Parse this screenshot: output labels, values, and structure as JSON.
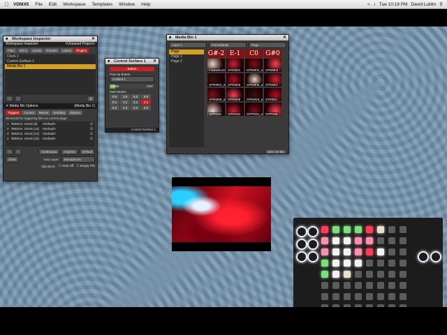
{
  "menubar": {
    "app": "VDMX5",
    "items": [
      "File",
      "Edit",
      "Workspace",
      "Templates",
      "Window",
      "Help"
    ],
    "clock": "Tue 10:19 PM",
    "user": "David Lublin"
  },
  "workspace_inspector": {
    "title": "Workspace Inspector",
    "project": "<Unsaved Project>",
    "tabs": [
      "Files",
      "Vid In",
      "Assets",
      "Presets",
      "Layers",
      "Plugins"
    ],
    "list": [
      "Clock 1",
      "Control Surface 1",
      "Media Bin 1"
    ]
  },
  "media_bin_options": {
    "title": "Media Bin Options",
    "target": "(Media Bin 1)",
    "tabs": [
      "Triggers",
      "Control",
      "Menus",
      "Sending",
      "Options"
    ],
    "shortcuts_label": "Shortcuts for triggering files on current page:",
    "rows": [
      {
        "n": "1",
        "path": "/MIDI/vn. Sinvle [8]",
        "val": "<Default>"
      },
      {
        "n": "2",
        "path": "/MIDI/vn. Sinvle [16]",
        "val": "<Default>"
      },
      {
        "n": "3",
        "path": "/MIDI/vn. Sinvle [24]",
        "val": "<Default>"
      },
      {
        "n": "4",
        "path": "/MIDI/vn. Sinvle [32]",
        "val": "<Default>"
      }
    ],
    "continuous": "Continuous",
    "anytime": "Anytime",
    "default": "Default",
    "clear": "Clear",
    "auto_layer_label": "Auto Layer:",
    "auto_layer_value": "Monophonic",
    "clip_eject_label": "Clip Eject:",
    "note_off": "Note Off",
    "empty_file": "Empty File"
  },
  "control_surface": {
    "title": "Control Surface 1",
    "button": "Button",
    "popup_label": "Pop-Up Button",
    "popup_value": "Untitled 1",
    "slider_label": "Slider",
    "slider_value": "0.07",
    "slider_level": 0.07,
    "multi_label": "Multi-Button",
    "grid": [
      "0.0",
      "1.0",
      "2.0",
      "3.0",
      "0.1",
      "1.1",
      "2.1",
      "3.1",
      "0.2",
      "1.2",
      "2.2",
      "3.2"
    ],
    "active_index": 7,
    "footer": "Control Surface 1"
  },
  "media_bin": {
    "title": "Media Bin 1",
    "layer": "Layer 1",
    "mode": "Immediately",
    "page_mode": "Page",
    "pages": [
      "Page",
      "Page 1",
      "Page 2"
    ],
    "headers": [
      "G#-2",
      "E-1",
      "C0",
      "G#0"
    ],
    "clips": [
      "FrameNumb",
      "GPEM01",
      "GPEM02_alt",
      "GPEM03",
      "GPEM04_alt",
      "GPEM05",
      "GPEM06_alt",
      "GPEM07",
      "GPEM08_alt",
      "GPEM09",
      "GPEM10_alt",
      "GPEB01",
      "GPPG02",
      "GPPG03",
      "GPPG04_alt",
      "GPPG05"
    ],
    "footer": "Size 1/2 Bin"
  },
  "launchpad": {
    "colors": {
      "green": "#7be07b",
      "pink": "#ff8fb0",
      "red": "#ff3b55",
      "white": "#f2f2f2",
      "grey": "#5c5c5c",
      "cream": "#e8e2c8"
    }
  }
}
